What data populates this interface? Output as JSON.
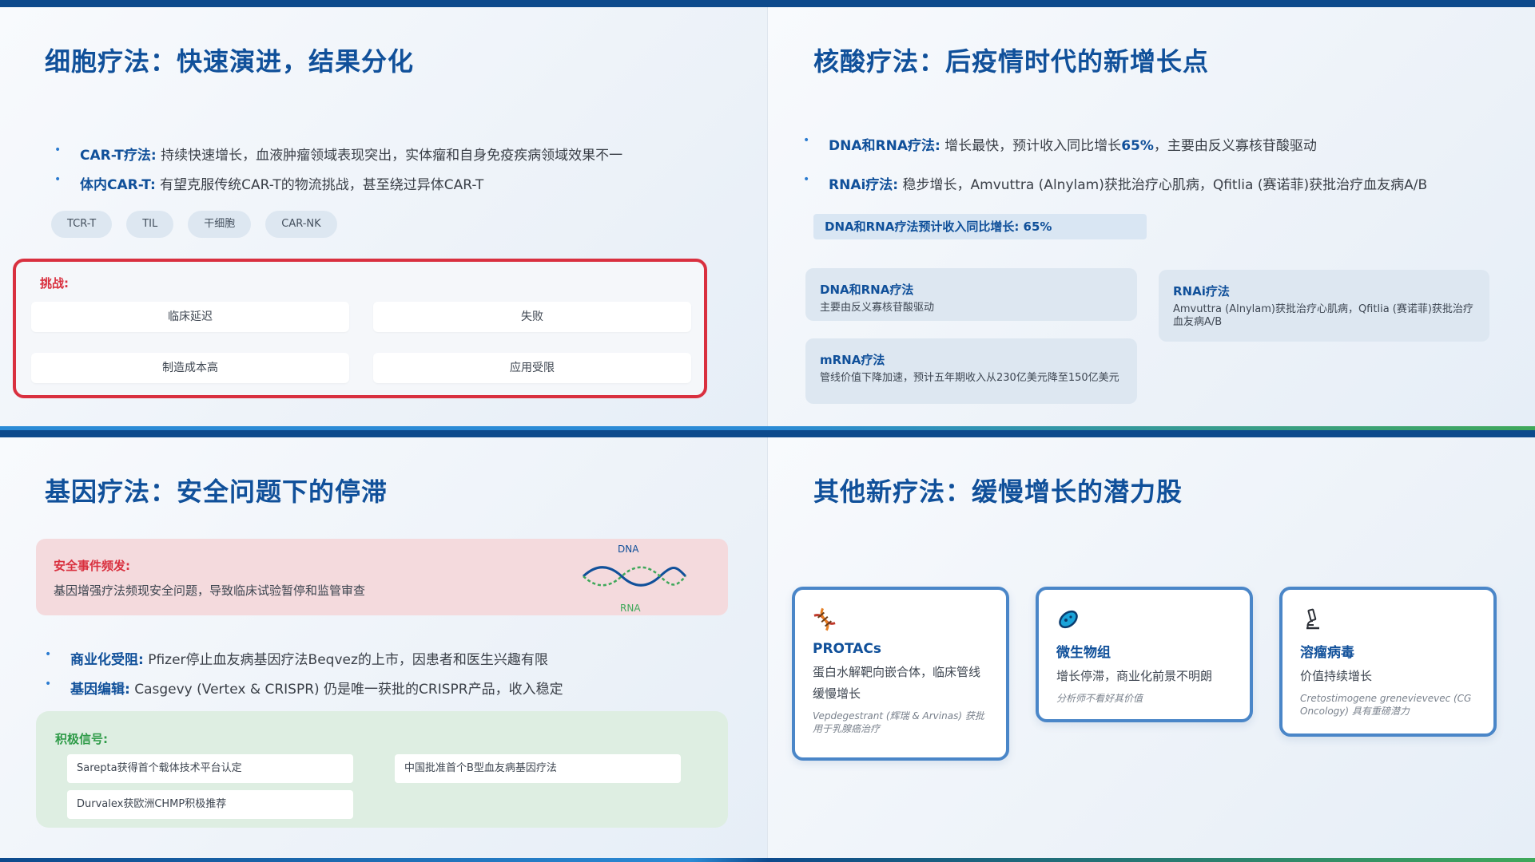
{
  "cell": {
    "title": "细胞疗法：快速演进，结果分化",
    "bullets": [
      {
        "label": "CAR-T疗法:",
        "text": " 持续快速增长，血液肿瘤领域表现突出，实体瘤和自身免疫疾病领域效果不一"
      },
      {
        "label": "体内CAR-T:",
        "text": " 有望克服传统CAR-T的物流挑战，甚至绕过异体CAR-T"
      }
    ],
    "pills": [
      "TCR-T",
      "TIL",
      "干细胞",
      "CAR-NK"
    ],
    "challenge_label": "挑战:",
    "challenges": [
      "临床延迟",
      "失败",
      "制造成本高",
      "应用受限"
    ],
    "accent_color": "#d9303f"
  },
  "nucleic": {
    "title": "核酸疗法：后疫情时代的新增长点",
    "bullets": [
      {
        "label": "DNA和RNA疗法:",
        "text_a": " 增长最快，预计收入同比增长",
        "highlight": "65%",
        "text_b": "，主要由反义寡核苷酸驱动"
      },
      {
        "label": "RNAi疗法:",
        "text": " 稳步增长，Amvuttra (Alnylam)获批治疗心肌病，Qfitlia (赛诺菲)获批治疗血友病A/B"
      }
    ],
    "growth_bar": "DNA和RNA疗法预计收入同比增长: 65%",
    "cards": [
      {
        "title": "DNA和RNA疗法",
        "desc": "主要由反义寡核苷酸驱动"
      },
      {
        "title": "RNAi疗法",
        "desc": "Amvuttra (Alnylam)获批治疗心肌病，Qfitlia (赛诺菲)获批治疗血友病A/B"
      },
      {
        "title": "mRNA疗法",
        "desc": "管线价值下降加速，预计五年期收入从230亿美元降至150亿美元"
      }
    ]
  },
  "gene": {
    "title": "基因疗法：安全问题下的停滞",
    "safety_label": "安全事件频发:",
    "safety_desc": "基因增强疗法频现安全问题，导致临床试验暂停和监管审查",
    "dna_label": "DNA",
    "rna_label": "RNA",
    "bullets": [
      {
        "label": "商业化受阻:",
        "text": " Pfizer停止血友病基因疗法Beqvez的上市，因患者和医生兴趣有限"
      },
      {
        "label": "基因编辑:",
        "text": " Casgevy (Vertex & CRISPR) 仍是唯一获批的CRISPR产品，收入稳定"
      }
    ],
    "positive_label": "积极信号:",
    "positives": [
      "Sarepta获得首个载体技术平台认定",
      "中国批准首个B型血友病基因疗法",
      "Durvalex获欧洲CHMP积极推荐"
    ],
    "positive_color": "#2e9b48"
  },
  "other": {
    "title": "其他新疗法：缓慢增长的潜力股",
    "cards": [
      {
        "icon": "dna-helix-icon",
        "title": "PROTACs",
        "desc": "蛋白水解靶向嵌合体，临床管线缓慢增长",
        "note": "Vepdegestrant (辉瑞 & Arvinas) 获批用于乳腺癌治疗"
      },
      {
        "icon": "microbe-icon",
        "title": "微生物组",
        "desc": "增长停滞，商业化前景不明朗",
        "note": "分析师不看好其价值"
      },
      {
        "icon": "microscope-icon",
        "title": "溶瘤病毒",
        "desc": "价值持续增长",
        "note": "Cretostimogene grenevievevec (CG Oncology) 具有重磅潜力"
      }
    ]
  },
  "theme": {
    "primary": "#10509a",
    "bar": "#0d4a8c",
    "accent_blue": "#2b8bd6",
    "accent_green": "#3fa85a"
  }
}
